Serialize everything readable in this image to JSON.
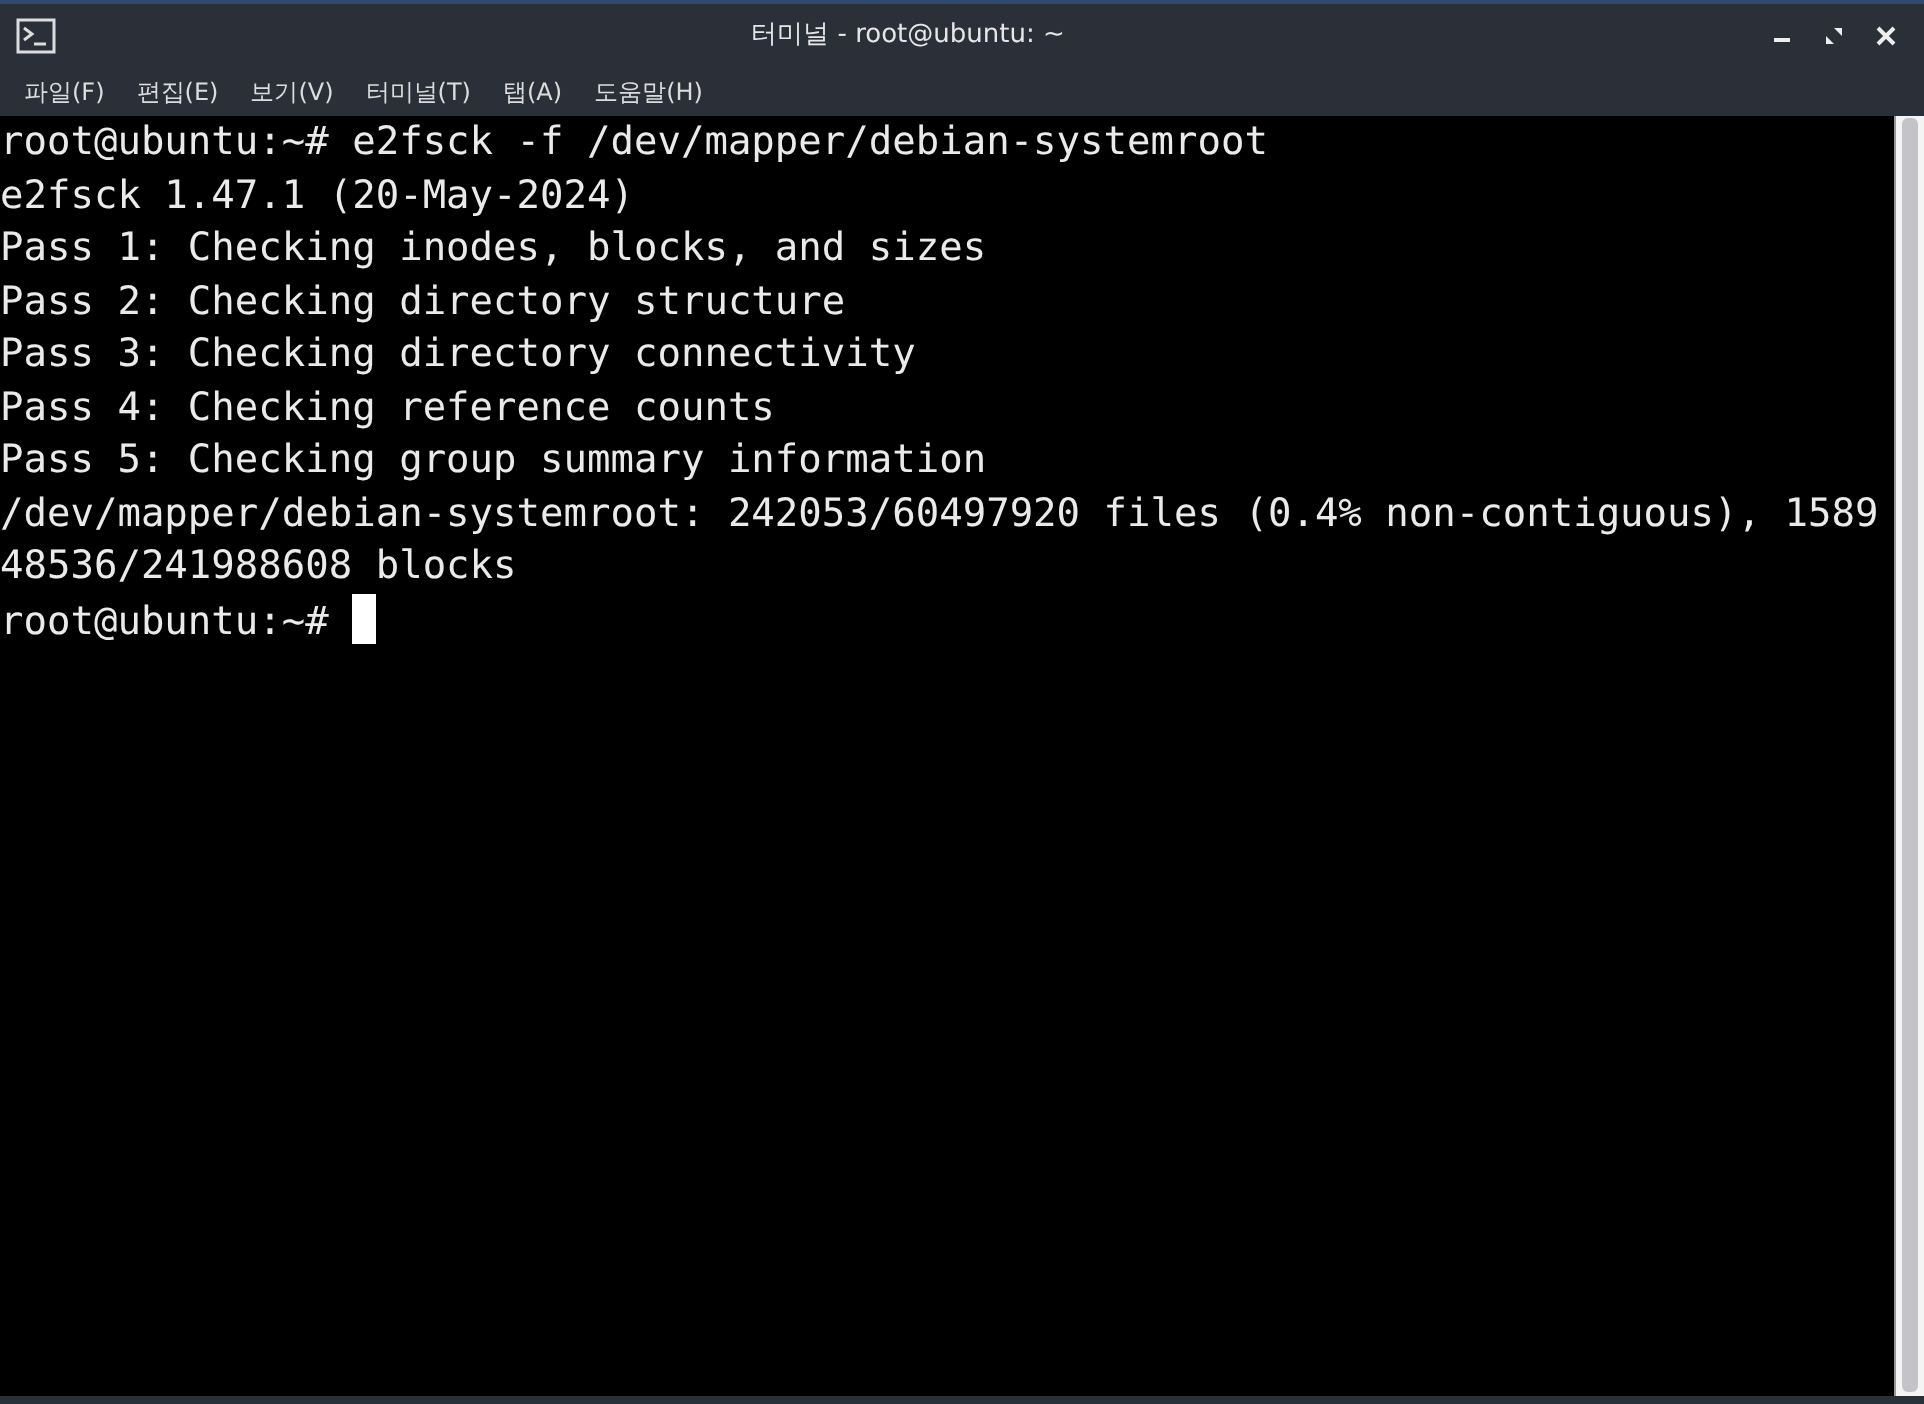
{
  "window": {
    "title": "터미널 - root@ubuntu: ~"
  },
  "menu": [
    "파일(F)",
    "편집(E)",
    "보기(V)",
    "터미널(T)",
    "탭(A)",
    "도움말(H)"
  ],
  "terminal": {
    "lines": [
      {
        "text": "root@ubuntu:~# e2fsck -f /dev/mapper/debian-systemroot",
        "cursor": false
      },
      {
        "text": "e2fsck 1.47.1 (20-May-2024)",
        "cursor": false
      },
      {
        "text": "Pass 1: Checking inodes, blocks, and sizes",
        "cursor": false
      },
      {
        "text": "Pass 2: Checking directory structure",
        "cursor": false
      },
      {
        "text": "Pass 3: Checking directory connectivity",
        "cursor": false
      },
      {
        "text": "Pass 4: Checking reference counts",
        "cursor": false
      },
      {
        "text": "Pass 5: Checking group summary information",
        "cursor": false
      },
      {
        "text": "/dev/mapper/debian-systemroot: 242053/60497920 files (0.4% non-contiguous), 1589",
        "cursor": false
      },
      {
        "text": "48536/241988608 blocks",
        "cursor": false
      },
      {
        "text": "root@ubuntu:~#",
        "cursor": true
      }
    ]
  }
}
